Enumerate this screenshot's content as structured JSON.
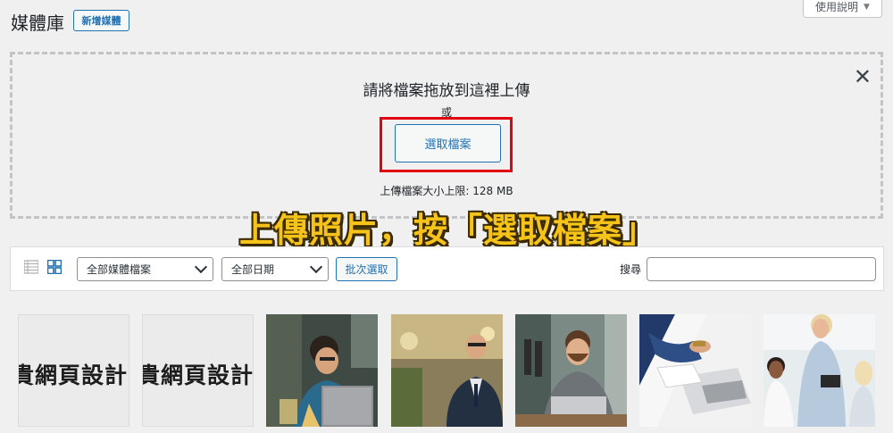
{
  "header": {
    "title": "媒體庫",
    "add_new_label": "新增媒體",
    "help_label": "使用說明"
  },
  "uploader": {
    "drop_title": "請將檔案拖放到這裡上傳",
    "or_label": "或",
    "select_files_label": "選取檔案",
    "max_size_label": "上傳檔案大小上限: 128 MB"
  },
  "caption": "上傳照片，按「選取檔案」",
  "toolbar": {
    "media_type_filter": "全部媒體檔案",
    "date_filter": "全部日期",
    "bulk_select_label": "批次選取",
    "search_label": "搜尋",
    "search_value": ""
  },
  "grid": {
    "items": [
      {
        "kind": "text-image",
        "text": "貴網頁設計"
      },
      {
        "kind": "text-image",
        "text": "貴網頁設計公"
      },
      {
        "kind": "photo",
        "scene": "smiling man with laptop"
      },
      {
        "kind": "photo",
        "scene": "businessman in suit with glasses"
      },
      {
        "kind": "photo",
        "scene": "bearded man with laptop at office"
      },
      {
        "kind": "photo",
        "scene": "hands with laptop and documents"
      },
      {
        "kind": "photo",
        "scene": "women colleagues in office"
      }
    ]
  },
  "colors": {
    "accent": "#2271b1",
    "highlight": "#e3000f",
    "caption_fill": "#f5c31a"
  }
}
